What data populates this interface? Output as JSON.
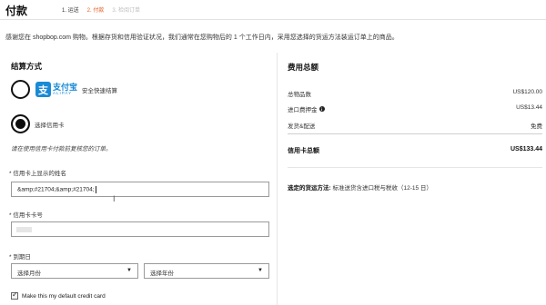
{
  "header": {
    "title": "付款",
    "steps": [
      {
        "label": "1. 运送",
        "state": "done"
      },
      {
        "label": "2. 付款",
        "state": "active"
      },
      {
        "label": "3. 检阅订单",
        "state": "todo"
      }
    ]
  },
  "intro": "感谢您在 shopbop.com 购物。根据存货和信用验证状况，我们通常在您购物后的 1 个工作日内，采用您选择的货运方法装运订单上的商品。",
  "payment": {
    "section_title": "结算方式",
    "alipay": {
      "logo_char": "支",
      "logo_cn": "支付宝",
      "logo_en": "ALIPAY",
      "label": "安全快速结算"
    },
    "credit_card": {
      "label": "选择信用卡"
    },
    "note": "请在使用信用卡付款前复核您的订单。",
    "name_label": "* 信用卡上显示的姓名",
    "name_value": "&amp;#21704;&amp;#21704;",
    "number_label": "* 信用卡卡号",
    "expiry_label": "* 到期日",
    "month_select": "选择月份",
    "year_select": "选择年份",
    "default_checkbox": "Make this my default credit card"
  },
  "summary": {
    "section_title": "费用总额",
    "rows": [
      {
        "label": "总物品数",
        "value": "US$120.00"
      },
      {
        "label": "进口费押金",
        "value": "US$13.44",
        "icon": "info-icon"
      },
      {
        "label": "发货&配送",
        "value": "免费"
      }
    ],
    "total_label": "信用卡总额",
    "total_value": "US$133.44",
    "shipping_label": "选定的货运方法:",
    "shipping_value": "标准送货含进口税与税收（12-15 日）"
  },
  "colors": {
    "accent": "#e25c1e",
    "alipay": "#1a8ad6"
  }
}
